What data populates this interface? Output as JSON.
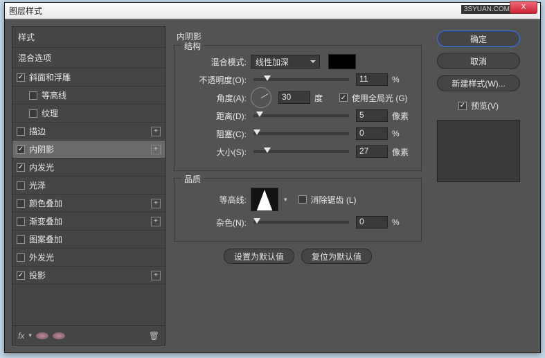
{
  "window": {
    "title": "图层样式",
    "brand": "3SYUAN.COM",
    "close": "X"
  },
  "left": {
    "styles_header": "样式",
    "blend_header": "混合选项",
    "items": [
      {
        "label": "斜面和浮雕",
        "checked": true,
        "plus": false,
        "indent": 0
      },
      {
        "label": "等高线",
        "checked": false,
        "plus": false,
        "indent": 1
      },
      {
        "label": "纹理",
        "checked": false,
        "plus": false,
        "indent": 1
      },
      {
        "label": "描边",
        "checked": false,
        "plus": true,
        "indent": 0
      },
      {
        "label": "内阴影",
        "checked": true,
        "plus": true,
        "indent": 0,
        "selected": true
      },
      {
        "label": "内发光",
        "checked": true,
        "plus": false,
        "indent": 0
      },
      {
        "label": "光泽",
        "checked": false,
        "plus": false,
        "indent": 0
      },
      {
        "label": "颜色叠加",
        "checked": false,
        "plus": true,
        "indent": 0
      },
      {
        "label": "渐变叠加",
        "checked": false,
        "plus": true,
        "indent": 0
      },
      {
        "label": "图案叠加",
        "checked": false,
        "plus": false,
        "indent": 0
      },
      {
        "label": "外发光",
        "checked": false,
        "plus": false,
        "indent": 0
      },
      {
        "label": "投影",
        "checked": true,
        "plus": true,
        "indent": 0
      }
    ],
    "fx": "fx"
  },
  "center": {
    "panel_title": "内阴影",
    "structure": {
      "title": "结构",
      "blend_mode_label": "混合模式:",
      "blend_mode_value": "线性加深",
      "swatch": "#000000",
      "opacity_label": "不透明度(O):",
      "opacity_value": "11",
      "opacity_unit": "%",
      "angle_label": "角度(A):",
      "angle_value": "30",
      "angle_unit": "度",
      "global_light_label": "使用全局光 (G)",
      "distance_label": "距离(D):",
      "distance_value": "5",
      "distance_unit": "像素",
      "choke_label": "阻塞(C):",
      "choke_value": "0",
      "choke_unit": "%",
      "size_label": "大小(S):",
      "size_value": "27",
      "size_unit": "像素"
    },
    "quality": {
      "title": "品质",
      "contour_label": "等高线:",
      "antialias_label": "消除锯齿 (L)",
      "noise_label": "杂色(N):",
      "noise_value": "0",
      "noise_unit": "%"
    },
    "buttons": {
      "default": "设置为默认值",
      "reset": "复位为默认值"
    }
  },
  "right": {
    "ok": "确定",
    "cancel": "取消",
    "new_style": "新建样式(W)...",
    "preview_label": "预览(V)"
  }
}
